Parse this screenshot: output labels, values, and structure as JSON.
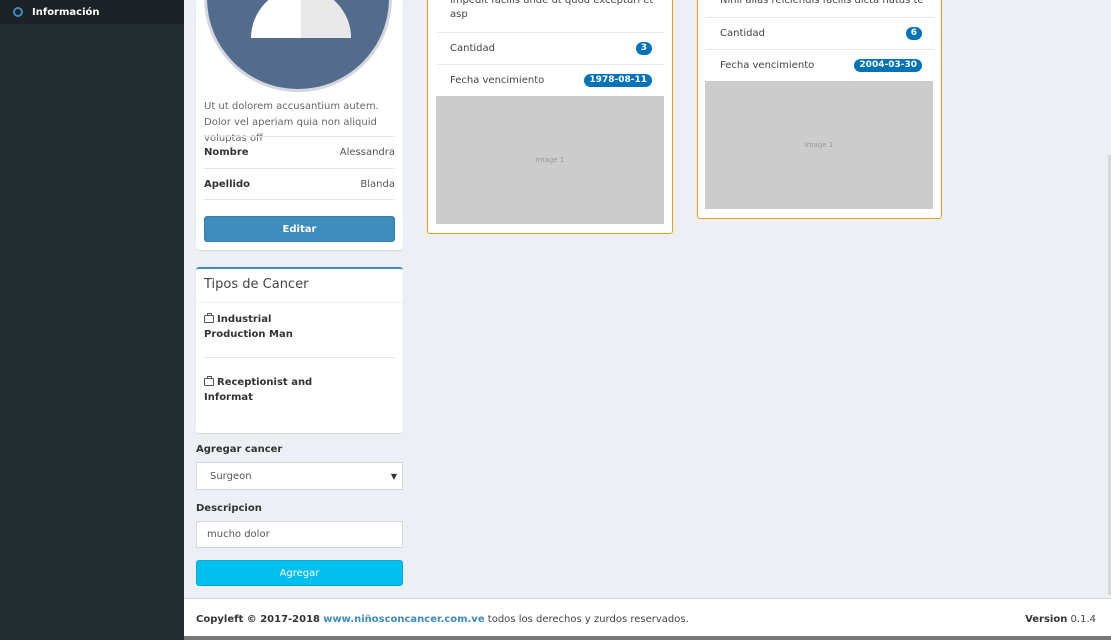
{
  "sidebar": {
    "items": [
      {
        "label": "Información",
        "icon": "circle-icon"
      }
    ]
  },
  "profile": {
    "description": "Ut ut dolorem accusantium autem. Dolor vel aperiam quia non aliquid voluptas off",
    "name_label": "Nombre",
    "name_value": "Alessandra",
    "lastname_label": "Apellido",
    "lastname_value": "Blanda",
    "edit_button": "Editar"
  },
  "cancer_types": {
    "title": "Tipos de Cancer",
    "items": [
      {
        "label": "Industrial Production Man",
        "icon": "briefcase-icon"
      },
      {
        "label": "Receptionist and Informat",
        "icon": "briefcase-icon"
      }
    ]
  },
  "add_form": {
    "cancer_label": "Agregar cancer",
    "cancer_selected": "Surgeon",
    "description_label": "Descripcion",
    "description_value": "mucho dolor",
    "submit_button": "Agregar"
  },
  "cards": [
    {
      "description": "impedit facilis unde ut quod excepturi et asp",
      "quantity_label": "Cantidad",
      "quantity": "3",
      "expiry_label": "Fecha vencimiento",
      "expiry": "1978-08-11",
      "image_label": "Image 1"
    },
    {
      "description": "Nihil alias reiciendis facilis dicta natus te",
      "quantity_label": "Cantidad",
      "quantity": "6",
      "expiry_label": "Fecha vencimiento",
      "expiry": "2004-03-30",
      "image_label": "Image 1"
    }
  ],
  "footer": {
    "copyleft": "Copyleft © 2017-2018",
    "link": "www.niñosconcancer.com.ve",
    "rights": "todos los derechos y zurdos reservados.",
    "version_label": "Version",
    "version": "0.1.4"
  },
  "colors": {
    "sidebar": "#222d32",
    "primary": "#3c8dbc",
    "info": "#00c0ef",
    "warning_border": "#f39c12",
    "badge": "#0073b7"
  }
}
